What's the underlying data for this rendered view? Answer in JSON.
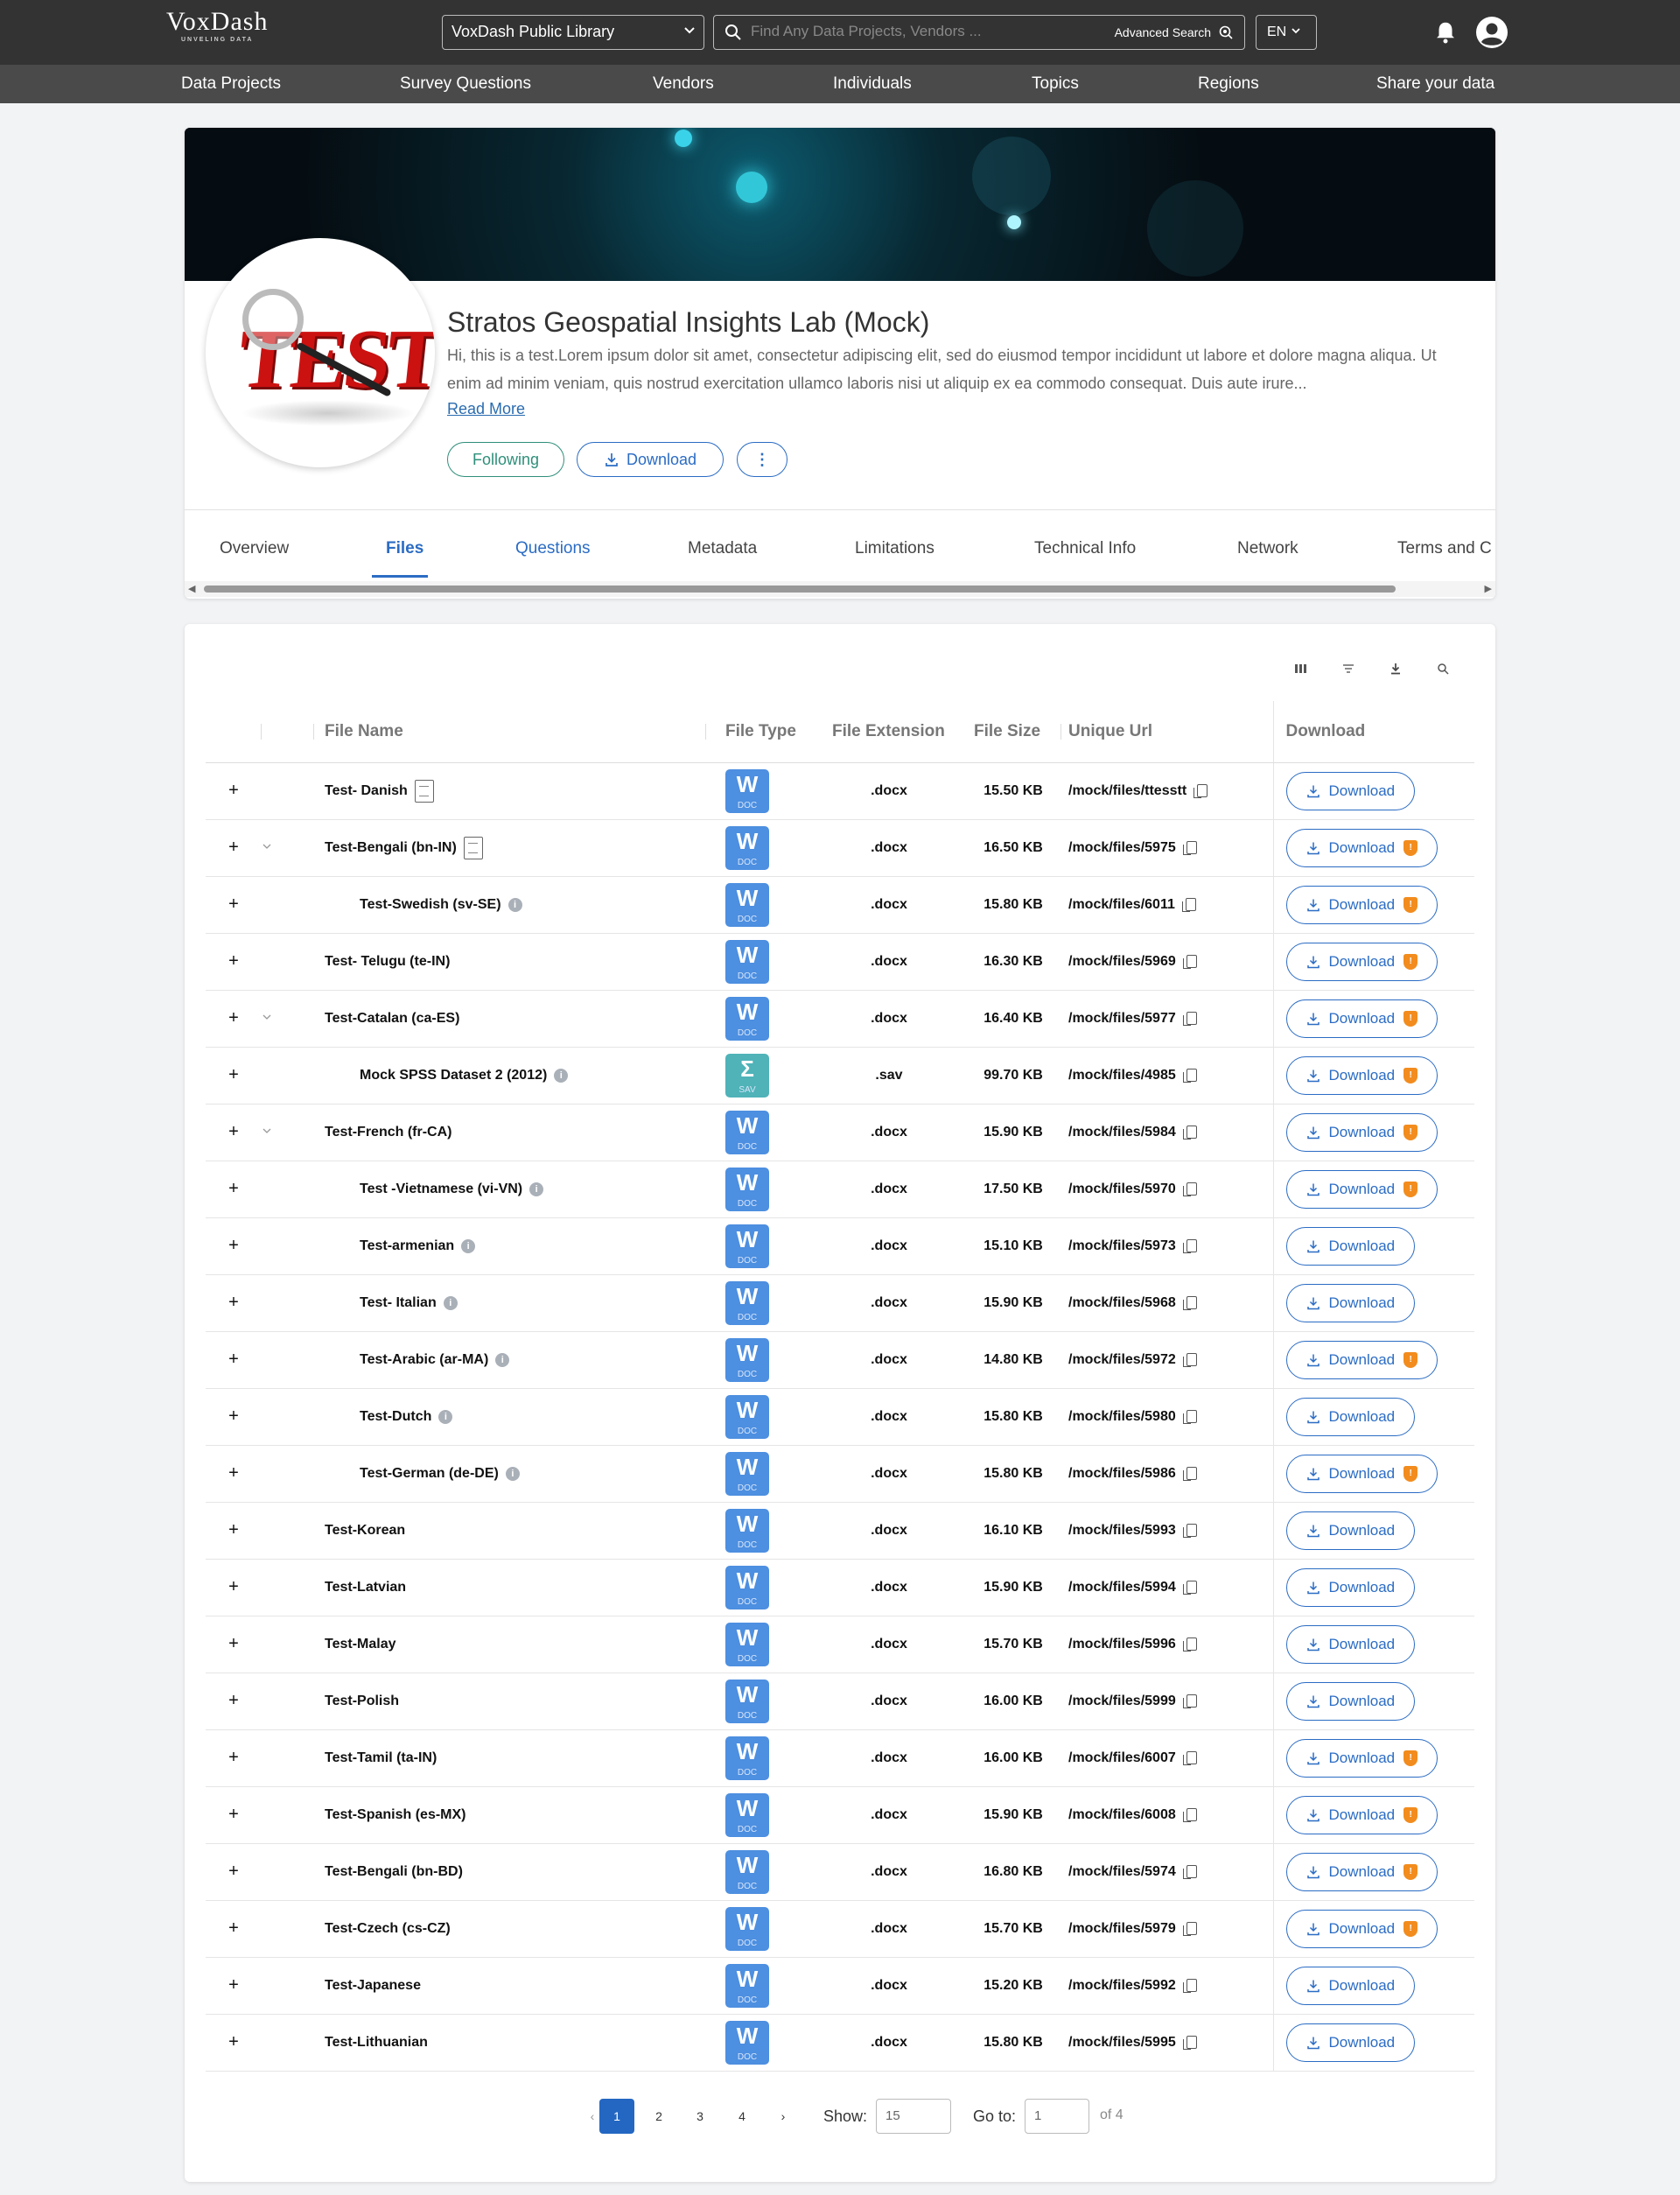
{
  "header": {
    "logo": "VoxDash",
    "tagline": "UNVELING DATA",
    "library": "VoxDash Public Library",
    "search_placeholder": "Find Any Data Projects, Vendors ...",
    "advanced_search": "Advanced Search",
    "language": "EN"
  },
  "nav": [
    "Data Projects",
    "Survey Questions",
    "Vendors",
    "Individuals",
    "Topics",
    "Regions",
    "Share your data"
  ],
  "profile": {
    "title": "Stratos Geospatial Insights Lab (Mock)",
    "description": "Hi, this is a test.Lorem ipsum dolor sit amet, consectetur adipiscing elit, sed do eiusmod tempor incididunt ut labore et dolore magna aliqua. Ut enim ad minim veniam, quis nostrud exercitation ullamco laboris nisi ut aliquip ex ea commodo consequat. Duis aute irure...",
    "read_more": "Read More",
    "logo_text": "TEST",
    "following_label": "Following",
    "download_label": "Download",
    "more_label": "⋮"
  },
  "tabs": [
    "Overview",
    "Files",
    "Questions",
    "Metadata",
    "Limitations",
    "Technical Info",
    "Network",
    "Terms and C"
  ],
  "table": {
    "headers": {
      "name": "File Name",
      "type": "File Type",
      "ext": "File Extension",
      "size": "File Size",
      "url": "Unique Url",
      "download": "Download"
    },
    "download_label": "Download",
    "rows": [
      {
        "name": "Test- Danish",
        "ext": ".docx",
        "size": "15.50 KB",
        "url": "/mock/files/ttesstt",
        "type": "doc",
        "level": 0,
        "expand": false,
        "doc": true,
        "info": false,
        "shield": false
      },
      {
        "name": "Test-Bengali (bn-IN)",
        "ext": ".docx",
        "size": "16.50 KB",
        "url": "/mock/files/5975",
        "type": "doc",
        "level": 0,
        "expand": true,
        "doc": true,
        "info": false,
        "shield": true
      },
      {
        "name": "Test-Swedish (sv-SE)",
        "ext": ".docx",
        "size": "15.80 KB",
        "url": "/mock/files/6011",
        "type": "doc",
        "level": 1,
        "expand": false,
        "doc": false,
        "info": true,
        "shield": true
      },
      {
        "name": "Test- Telugu (te-IN)",
        "ext": ".docx",
        "size": "16.30 KB",
        "url": "/mock/files/5969",
        "type": "doc",
        "level": 0,
        "expand": false,
        "doc": false,
        "info": false,
        "shield": true
      },
      {
        "name": "Test-Catalan (ca-ES)",
        "ext": ".docx",
        "size": "16.40 KB",
        "url": "/mock/files/5977",
        "type": "doc",
        "level": 0,
        "expand": true,
        "doc": false,
        "info": false,
        "shield": true
      },
      {
        "name": "Mock SPSS Dataset 2 (2012)",
        "ext": ".sav",
        "size": "99.70 KB",
        "url": "/mock/files/4985",
        "type": "sav",
        "level": 1,
        "expand": false,
        "doc": false,
        "info": true,
        "shield": true
      },
      {
        "name": "Test-French (fr-CA)",
        "ext": ".docx",
        "size": "15.90 KB",
        "url": "/mock/files/5984",
        "type": "doc",
        "level": 0,
        "expand": true,
        "doc": false,
        "info": false,
        "shield": true
      },
      {
        "name": "Test -Vietnamese (vi-VN)",
        "ext": ".docx",
        "size": "17.50 KB",
        "url": "/mock/files/5970",
        "type": "doc",
        "level": 1,
        "expand": false,
        "doc": false,
        "info": true,
        "shield": true
      },
      {
        "name": "Test-armenian",
        "ext": ".docx",
        "size": "15.10 KB",
        "url": "/mock/files/5973",
        "type": "doc",
        "level": 1,
        "expand": false,
        "doc": false,
        "info": true,
        "shield": false
      },
      {
        "name": "Test- Italian",
        "ext": ".docx",
        "size": "15.90 KB",
        "url": "/mock/files/5968",
        "type": "doc",
        "level": 1,
        "expand": false,
        "doc": false,
        "info": true,
        "shield": false
      },
      {
        "name": "Test-Arabic (ar-MA)",
        "ext": ".docx",
        "size": "14.80 KB",
        "url": "/mock/files/5972",
        "type": "doc",
        "level": 1,
        "expand": false,
        "doc": false,
        "info": true,
        "shield": true
      },
      {
        "name": "Test-Dutch",
        "ext": ".docx",
        "size": "15.80 KB",
        "url": "/mock/files/5980",
        "type": "doc",
        "level": 1,
        "expand": false,
        "doc": false,
        "info": true,
        "shield": false
      },
      {
        "name": "Test-German (de-DE)",
        "ext": ".docx",
        "size": "15.80 KB",
        "url": "/mock/files/5986",
        "type": "doc",
        "level": 1,
        "expand": false,
        "doc": false,
        "info": true,
        "shield": true
      },
      {
        "name": "Test-Korean",
        "ext": ".docx",
        "size": "16.10 KB",
        "url": "/mock/files/5993",
        "type": "doc",
        "level": 0,
        "expand": false,
        "doc": false,
        "info": false,
        "shield": false
      },
      {
        "name": "Test-Latvian",
        "ext": ".docx",
        "size": "15.90 KB",
        "url": "/mock/files/5994",
        "type": "doc",
        "level": 0,
        "expand": false,
        "doc": false,
        "info": false,
        "shield": false
      },
      {
        "name": "Test-Malay",
        "ext": ".docx",
        "size": "15.70 KB",
        "url": "/mock/files/5996",
        "type": "doc",
        "level": 0,
        "expand": false,
        "doc": false,
        "info": false,
        "shield": false
      },
      {
        "name": "Test-Polish",
        "ext": ".docx",
        "size": "16.00 KB",
        "url": "/mock/files/5999",
        "type": "doc",
        "level": 0,
        "expand": false,
        "doc": false,
        "info": false,
        "shield": false
      },
      {
        "name": "Test-Tamil (ta-IN)",
        "ext": ".docx",
        "size": "16.00 KB",
        "url": "/mock/files/6007",
        "type": "doc",
        "level": 0,
        "expand": false,
        "doc": false,
        "info": false,
        "shield": true
      },
      {
        "name": "Test-Spanish (es-MX)",
        "ext": ".docx",
        "size": "15.90 KB",
        "url": "/mock/files/6008",
        "type": "doc",
        "level": 0,
        "expand": false,
        "doc": false,
        "info": false,
        "shield": true
      },
      {
        "name": "Test-Bengali (bn-BD)",
        "ext": ".docx",
        "size": "16.80 KB",
        "url": "/mock/files/5974",
        "type": "doc",
        "level": 0,
        "expand": false,
        "doc": false,
        "info": false,
        "shield": true
      },
      {
        "name": "Test-Czech (cs-CZ)",
        "ext": ".docx",
        "size": "15.70 KB",
        "url": "/mock/files/5979",
        "type": "doc",
        "level": 0,
        "expand": false,
        "doc": false,
        "info": false,
        "shield": true
      },
      {
        "name": "Test-Japanese",
        "ext": ".docx",
        "size": "15.20 KB",
        "url": "/mock/files/5992",
        "type": "doc",
        "level": 0,
        "expand": false,
        "doc": false,
        "info": false,
        "shield": false
      },
      {
        "name": "Test-Lithuanian",
        "ext": ".docx",
        "size": "15.80 KB",
        "url": "/mock/files/5995",
        "type": "doc",
        "level": 0,
        "expand": false,
        "doc": false,
        "info": false,
        "shield": false
      }
    ]
  },
  "pagination": {
    "pages": [
      "1",
      "2",
      "3",
      "4"
    ],
    "current": "1",
    "show_label": "Show:",
    "show_value": "15",
    "goto_label": "Go to:",
    "goto_value": "1",
    "of_label": "of 4"
  },
  "colors": {
    "accent": "#2b6cc4",
    "follow": "#2f8f7a",
    "shield": "#f28c1e",
    "doc_icon": "#4d8fe0",
    "sav_icon": "#4fb3b8"
  }
}
